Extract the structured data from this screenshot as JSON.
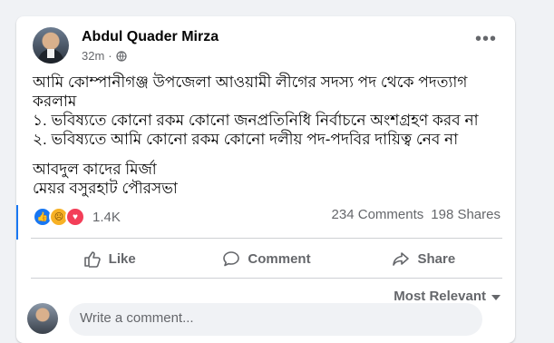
{
  "post": {
    "author": "Abdul Quader Mirza",
    "time": "32m",
    "privacy_icon": "globe-icon",
    "more_label": "•••",
    "lines": [
      "আমি কোম্পানীগঞ্জ উপজেলা আওয়ামী লীগের সদস্য পদ থেকে পদত্যাগ করলাম",
      "১. ভবিষ্যতে কোনো রকম কোনো জনপ্রতিনিধি নির্বাচনে অংশগ্রহণ করব না",
      "২. ভবিষ্যতে আমি কোনো রকম কোনো দলীয় পদ-পদবির দায়িত্ব নেব না"
    ],
    "signature": [
      "আবদুল কাদের মির্জা",
      "মেয়র বসুরহাট পৌরসভা"
    ]
  },
  "stats": {
    "reaction_icons": [
      "like-icon",
      "sad-icon",
      "love-icon"
    ],
    "reaction_count": "1.4K",
    "comments": "234 Comments",
    "shares": "198 Shares"
  },
  "actions": {
    "like": "Like",
    "comment": "Comment",
    "share": "Share"
  },
  "comments": {
    "sort_label": "Most Relevant",
    "input_placeholder": "Write a comment..."
  },
  "colors": {
    "accent": "#1877f2",
    "text": "#050505",
    "secondary": "#65676b"
  }
}
